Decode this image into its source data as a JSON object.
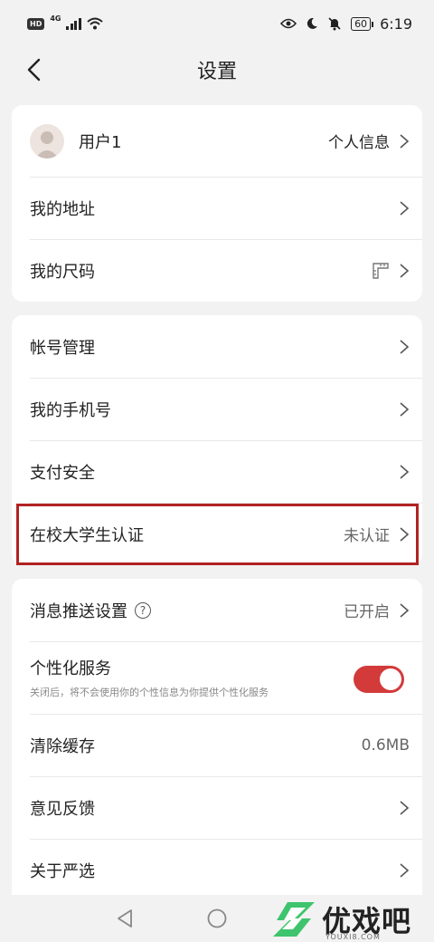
{
  "status": {
    "hd": "HD",
    "network": "4G",
    "battery": "60",
    "time": "6:19"
  },
  "header": {
    "title": "设置"
  },
  "profile": {
    "name": "用户1",
    "link": "个人信息"
  },
  "group1": {
    "address": "我的地址",
    "size": "我的尺码"
  },
  "group2": {
    "account": "帐号管理",
    "phone": "我的手机号",
    "payment": "支付安全",
    "student": "在校大学生认证",
    "student_status": "未认证"
  },
  "group3": {
    "push": "消息推送设置",
    "push_status": "已开启",
    "personal": "个性化服务",
    "personal_desc": "关闭后，将不会使用你的个性信息为你提供个性化服务",
    "personal_enabled": true,
    "cache": "清除缓存",
    "cache_size": "0.6MB",
    "feedback": "意见反馈",
    "about": "关于严选"
  },
  "watermark": {
    "text": "优戏吧",
    "url": "YOUXI8.COM"
  },
  "colors": {
    "accent": "#d33a3a",
    "highlight": "#b22222"
  }
}
